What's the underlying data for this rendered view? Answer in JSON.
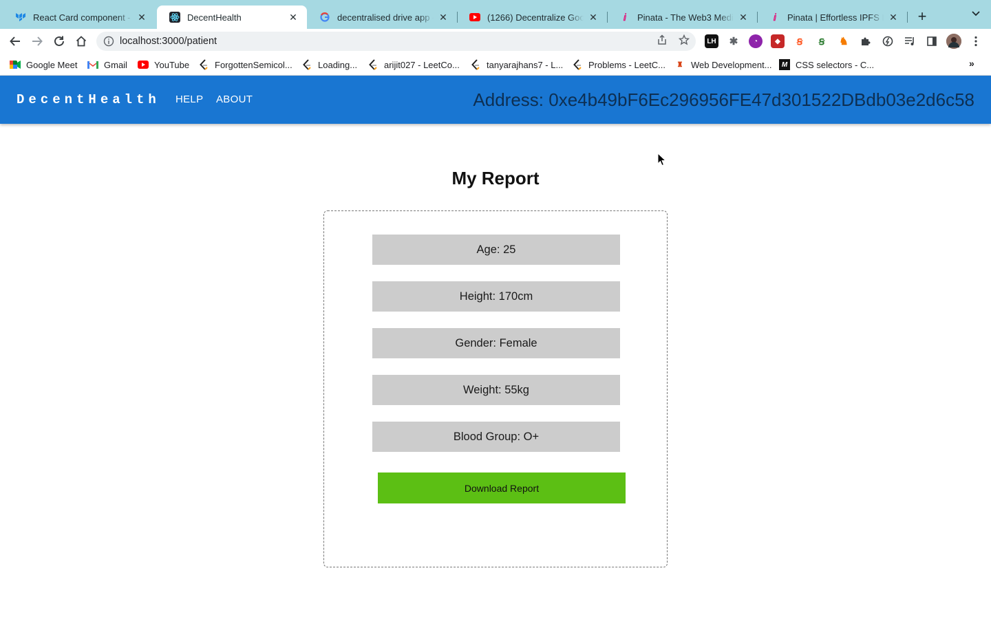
{
  "tabs": [
    {
      "title": "React Card component - M",
      "favicon": "mui-icon",
      "color": "#1e88e5"
    },
    {
      "title": "DecentHealth",
      "favicon": "react-icon",
      "color": "#222222",
      "active": true
    },
    {
      "title": "decentralised drive app - G",
      "favicon": "google-icon",
      "color": "#4285f4"
    },
    {
      "title": "(1266) Decentralize Google",
      "favicon": "youtube-icon",
      "color": "#ff0000"
    },
    {
      "title": "Pinata - The Web3 Media P",
      "favicon": "pinata-icon",
      "color": "#e0177a"
    },
    {
      "title": "Pinata | Effortless IPFS File",
      "favicon": "pinata-icon",
      "color": "#e0177a"
    }
  ],
  "toolbar": {
    "url": "localhost:3000/patient"
  },
  "bookmarks": [
    {
      "label": "Google Meet",
      "icon": "meet-icon"
    },
    {
      "label": "Gmail",
      "icon": "gmail-icon"
    },
    {
      "label": "YouTube",
      "icon": "youtube-icon"
    },
    {
      "label": "ForgottenSemicol...",
      "icon": "leetcode-icon"
    },
    {
      "label": "Loading...",
      "icon": "leetcode-icon"
    },
    {
      "label": "arijit027 - LeetCo...",
      "icon": "leetcode-icon"
    },
    {
      "label": "tanyarajhans7 - L...",
      "icon": "leetcode-icon"
    },
    {
      "label": "Problems - LeetC...",
      "icon": "leetcode-icon"
    },
    {
      "label": "Web Development...",
      "icon": "web-dev-icon"
    },
    {
      "label": "CSS selectors - C...",
      "icon": "medium-icon"
    }
  ],
  "app": {
    "brand": "DecentHealth",
    "nav_help": "HELP",
    "nav_about": "ABOUT",
    "address": "Address: 0xe4b49bF6Ec296956FE47d301522DBdb03e2d6c58",
    "title": "My Report",
    "fields": {
      "age": "Age: 25",
      "height": "Height: 170cm",
      "gender": "Gender: Female",
      "weight": "Weight: 55kg",
      "blood_group": "Blood Group: O+"
    },
    "download_label": "Download Report"
  },
  "colors": {
    "tabstrip": "#a6d9e2",
    "appbar": "#1976d2",
    "field_bg": "#cccccc",
    "download_btn": "#5cbf14"
  }
}
